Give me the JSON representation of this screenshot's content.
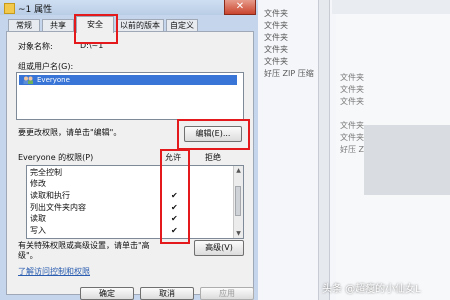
{
  "explorer_bg": {
    "left_items": [
      "文件夹",
      "文件夹",
      "文件夹",
      "文件夹",
      "文件夹",
      "好压 ZIP 压缩"
    ],
    "right_items": [
      "文件夹",
      "文件夹",
      "文件夹",
      "文件夹",
      "文件夹",
      "好压 ZIP 压缩"
    ]
  },
  "dialog": {
    "title": "~1 属性",
    "close_glyph": "✕",
    "tabs": [
      {
        "label": "常规"
      },
      {
        "label": "共享"
      },
      {
        "label": "安全"
      },
      {
        "label": "以前的版本"
      },
      {
        "label": "自定义"
      }
    ],
    "object_name_label": "对象名称:",
    "object_name_value": "D:\\~1",
    "groups_label": "组或用户名(G):",
    "groups_list": [
      {
        "name": "Everyone"
      }
    ],
    "change_perm_text": "要更改权限，请单击\"编辑\"。",
    "edit_button": "编辑(E)...",
    "perm_for_label": "Everyone 的权限(P)",
    "allow_header": "允许",
    "deny_header": "拒绝",
    "permissions": [
      {
        "name": "完全控制",
        "allow": ""
      },
      {
        "name": "修改",
        "allow": ""
      },
      {
        "name": "读取和执行",
        "allow": "✔"
      },
      {
        "name": "列出文件夹内容",
        "allow": "✔"
      },
      {
        "name": "读取",
        "allow": "✔"
      },
      {
        "name": "写入",
        "allow": "✔"
      }
    ],
    "special_text_line1": "有关特殊权限或高级设置，请单击\"高",
    "special_text_line2": "级\"。",
    "advanced_button": "高级(V)",
    "learn_link": "了解访问控制和权限",
    "ok_button": "确定",
    "cancel_button": "取消",
    "apply_button": "应用"
  },
  "watermark": "头条 @超瘦的小仙女L",
  "colors": {
    "highlight_red": "#e4191c",
    "selection_blue": "#3875d7",
    "link_blue": "#2a5db0"
  }
}
